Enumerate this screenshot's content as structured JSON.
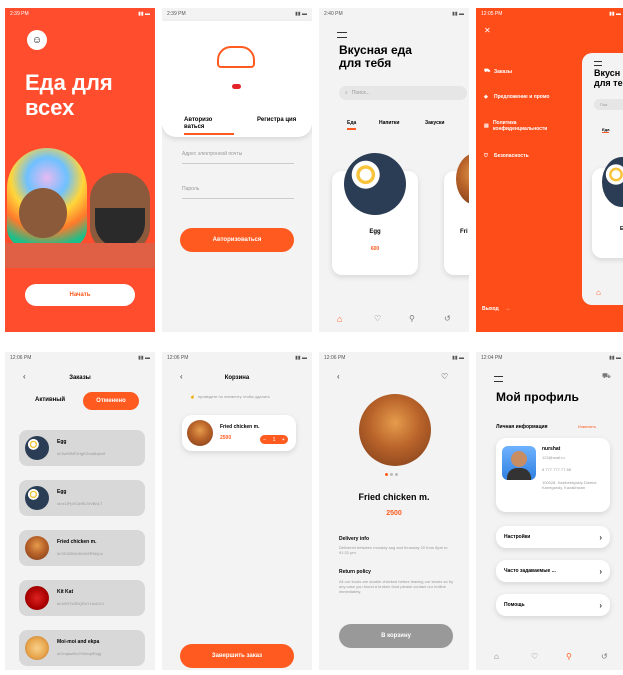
{
  "s1": {
    "time": "2:39 PM",
    "title_line1": "Еда для",
    "title_line2": "всех",
    "start": "Начать"
  },
  "s2": {
    "time": "2:39 PM",
    "tab_login": "Авторизо ваться",
    "tab_register": "Регистра ция",
    "email_ph": "Адрес электронной почты",
    "pass_ph": "Пароль",
    "login_btn": "Авторизоваться"
  },
  "s3": {
    "time": "2:40 PM",
    "heading1": "Вкусная еда",
    "heading2": "для тебя",
    "search": "Поиск...",
    "tabs": [
      "Еда",
      "Напитки",
      "Закуски"
    ],
    "card_name": "Egg",
    "card_price": "600",
    "card2_name": "Fri"
  },
  "s4": {
    "time": "12:05 PM",
    "menu": [
      "Заказы",
      "Предложение и промо",
      "Политика конфиденциальности",
      "Безопасность"
    ],
    "logout": "Выход",
    "peek_heading1": "Вкусн",
    "peek_heading2": "для те",
    "peek_search": "Пои",
    "peek_tab": "Еда",
    "peek_card": "E"
  },
  "s5": {
    "time": "12:06 PM",
    "title": "Заказы",
    "tab_active": "Активный",
    "tab_cancel": "Отменено",
    "orders": [
      {
        "name": "Egg",
        "id": "id:3w90NF2rIgKDnuMqeoif"
      },
      {
        "name": "Egg",
        "id": "id:rz1IPpXGk9SJVVBh1T"
      },
      {
        "name": "Fried chicken m.",
        "id": "id:SDIl2fWUib1M2RNhj.io"
      },
      {
        "name": "Kit Kat",
        "id": "id:ASHTsSBQRoYLhzKGJ"
      },
      {
        "name": "Moi-moi and ekpa",
        "id": "id:2mjswtDuTrWnqbRujg"
      }
    ]
  },
  "s6": {
    "time": "12:06 PM",
    "title": "Корзина",
    "hint": "проведите по элементу чтобы удалить",
    "item_name": "Fried chicken m.",
    "item_price": "2500",
    "qty": "1",
    "checkout": "Завершить заказ"
  },
  "s7": {
    "time": "12:06 PM",
    "name": "Fried chicken m.",
    "price": "2500",
    "delivery_title": "Delivery info",
    "delivery_text": "Delivered between monday aug and thursday 20 from 8pm to 91:32 pm",
    "return_title": "Return policy",
    "return_text": "All our foods are double checked before leaving our stores so by any case you found a broken food please contact our hotline immediately.",
    "cart_btn": "В корзину"
  },
  "s8": {
    "time": "12:04 PM",
    "title": "Мой профиль",
    "section": "Личная информация",
    "edit": "Изменить",
    "user": "nurshat",
    "email": "123@mail.ru",
    "phone": "8 777 777 77 88",
    "address": "100028, Kazibekbyskiy District, Kanegandy, Kazakhstan",
    "items": [
      "Настройки",
      "Часто задаваемые ...",
      "Помощь"
    ]
  },
  "colors": {
    "accent": "#ff5a1f",
    "panel": "#f3f3f3"
  }
}
